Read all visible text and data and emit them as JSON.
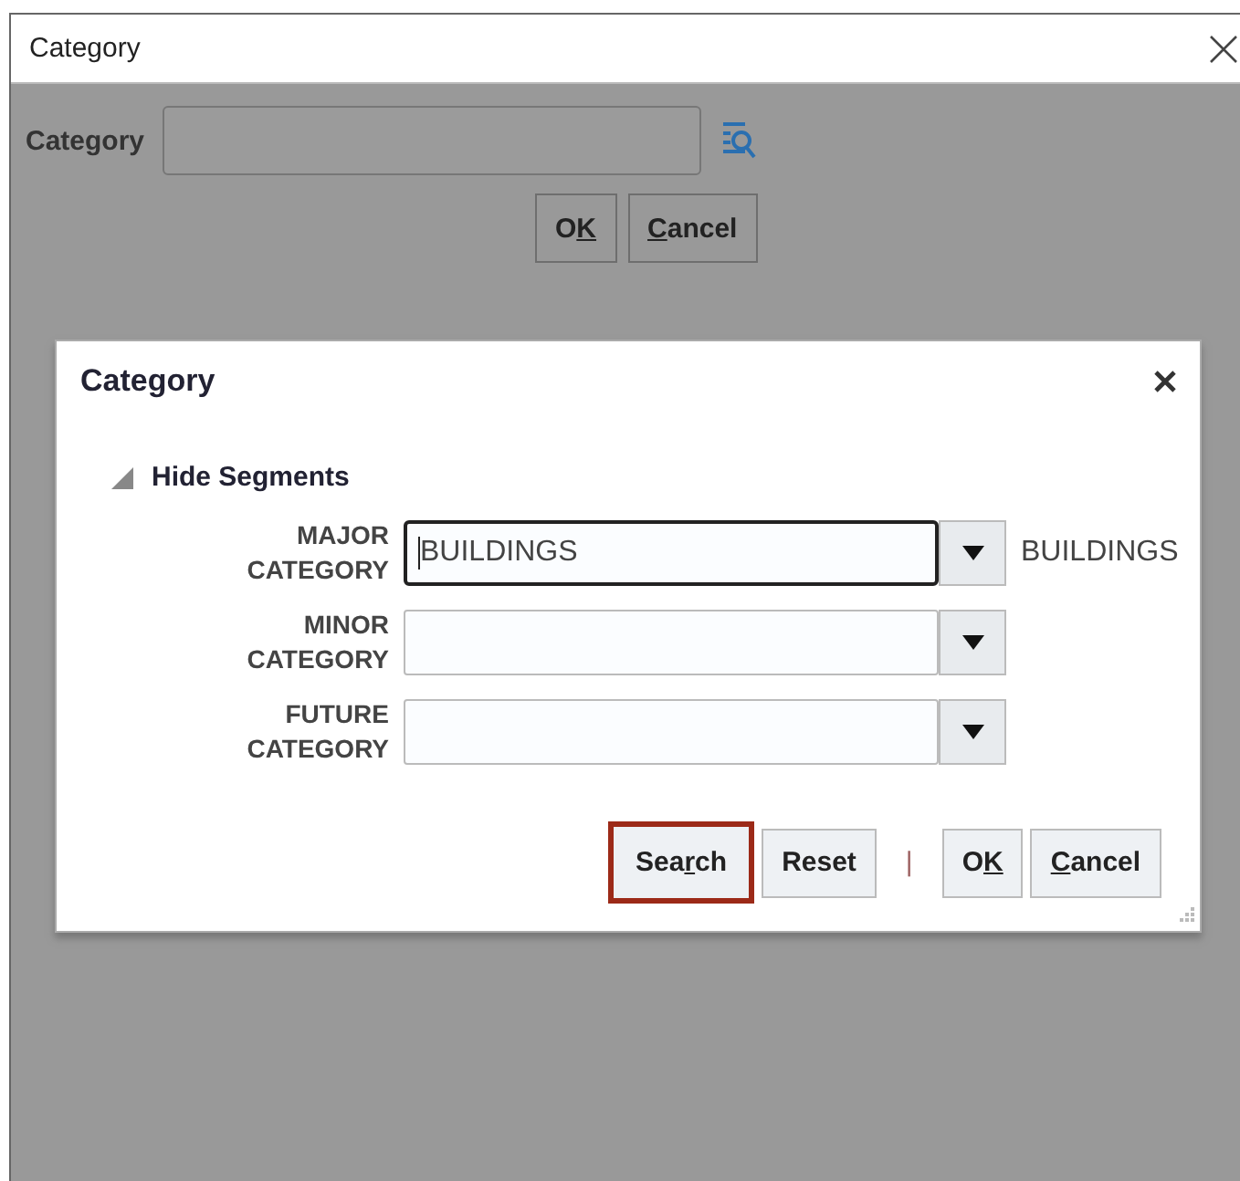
{
  "window": {
    "title": "Category"
  },
  "form": {
    "label": "Category"
  },
  "buttons": [
    {
      "before": "O",
      "key": "K"
    },
    {
      "key": "C",
      "after": "ancel"
    }
  ],
  "dialog": {
    "title": "Category",
    "toggle": {
      "label": "Hide Segments",
      "expanded": true
    },
    "segments": [
      {
        "label_lines": [
          "MAJOR",
          "CATEGORY"
        ],
        "value": "BUILDINGS",
        "focused": true,
        "description": "BUILDINGS"
      },
      {
        "label_lines": [
          "MINOR",
          "CATEGORY"
        ],
        "focused": false
      },
      {
        "label_lines": [
          "FUTURE",
          "CATEGORY"
        ],
        "focused": false
      }
    ],
    "buttons": [
      {
        "kind": "action",
        "before": "Sea",
        "key": "r",
        "after": "ch",
        "highlighted": true
      },
      {
        "kind": "action",
        "before": "Reset",
        "highlighted": false
      },
      {
        "kind": "separator",
        "text": "|"
      },
      {
        "kind": "action",
        "before": "O",
        "key": "K",
        "highlighted": false
      },
      {
        "kind": "action",
        "key": "C",
        "after": "ancel",
        "highlighted": false
      }
    ]
  }
}
